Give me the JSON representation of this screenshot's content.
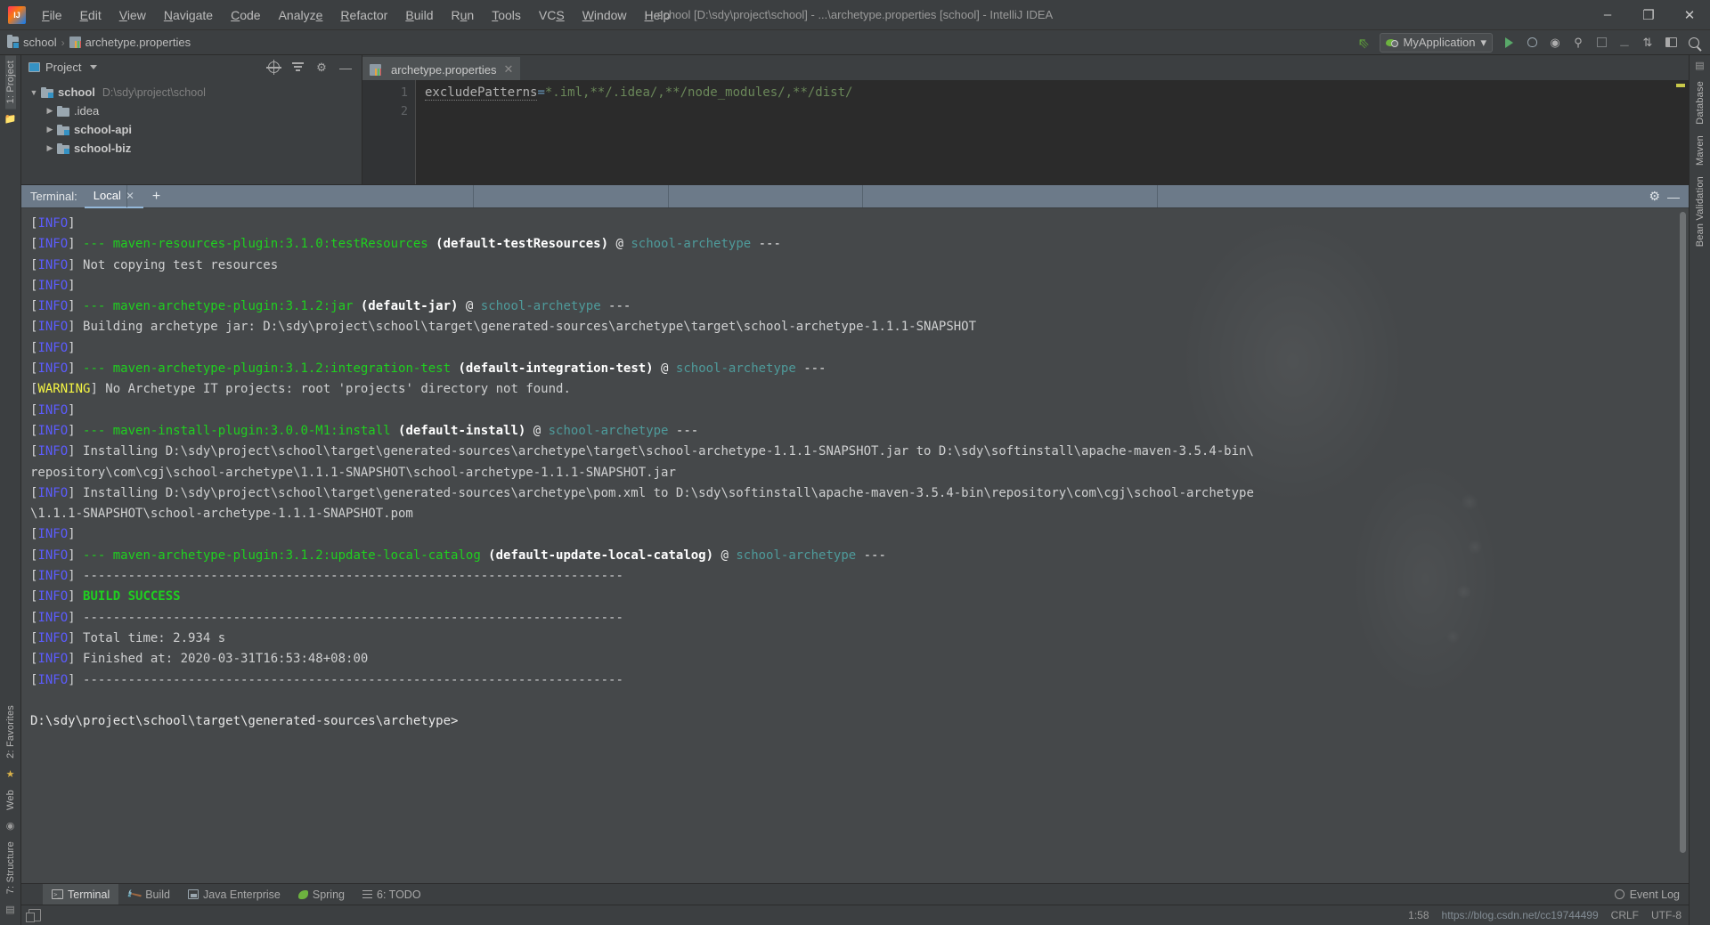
{
  "window": {
    "title": "school [D:\\sdy\\project\\school] - ...\\archetype.properties [school] - IntelliJ IDEA",
    "minimize": "–",
    "maximize": "❐",
    "close": "✕"
  },
  "menu": [
    {
      "label": "File"
    },
    {
      "label": "Edit"
    },
    {
      "label": "View"
    },
    {
      "label": "Navigate"
    },
    {
      "label": "Code"
    },
    {
      "label": "Analyze"
    },
    {
      "label": "Refactor"
    },
    {
      "label": "Build"
    },
    {
      "label": "Run"
    },
    {
      "label": "Tools"
    },
    {
      "label": "VCS"
    },
    {
      "label": "Window"
    },
    {
      "label": "Help"
    }
  ],
  "navbar": {
    "crumbs": [
      "school",
      "archetype.properties"
    ],
    "separator": "›",
    "run_config": "MyApplication",
    "run_config_caret": "▾"
  },
  "project_panel": {
    "title": "Project",
    "caret": "▾",
    "tree": [
      {
        "name": "school",
        "path": "D:\\sdy\\project\\school",
        "twisty": "▼",
        "depth": 0,
        "bold": true,
        "module": true
      },
      {
        "name": ".idea",
        "path": "",
        "twisty": "▶",
        "depth": 1,
        "bold": false,
        "module": false
      },
      {
        "name": "school-api",
        "path": "",
        "twisty": "▶",
        "depth": 1,
        "bold": true,
        "module": true
      },
      {
        "name": "school-biz",
        "path": "",
        "twisty": "▶",
        "depth": 1,
        "bold": true,
        "module": true
      }
    ]
  },
  "editor": {
    "tab_label": "archetype.properties",
    "tab_close": "✕",
    "line_numbers": [
      "1",
      "2"
    ],
    "code_key": "excludePatterns",
    "code_eq": "=",
    "code_value": "*.iml,**/.idea/,**/node_modules/,**/dist/"
  },
  "terminal": {
    "label": "Terminal:",
    "tab": "Local",
    "tab_close": "✕",
    "add": "+",
    "gear": "⚙",
    "minimize": "—",
    "prompt": "D:\\sdy\\project\\school\\target\\generated-sources\\archetype>",
    "lines": [
      [
        {
          "t": "[",
          "c": "br"
        },
        {
          "t": "INFO",
          "c": "info"
        },
        {
          "t": "]",
          "c": "br"
        }
      ],
      [
        {
          "t": "[",
          "c": "br"
        },
        {
          "t": "INFO",
          "c": "info"
        },
        {
          "t": "] ",
          "c": "br"
        },
        {
          "t": "--- ",
          "c": "green"
        },
        {
          "t": "maven-resources-plugin:3.1.0:testResources",
          "c": "green"
        },
        {
          "t": " (default-testResources)",
          "c": "bold"
        },
        {
          "t": " @ ",
          "c": "white"
        },
        {
          "t": "school-archetype",
          "c": "cyan"
        },
        {
          "t": " ---",
          "c": "white"
        }
      ],
      [
        {
          "t": "[",
          "c": "br"
        },
        {
          "t": "INFO",
          "c": "info"
        },
        {
          "t": "] Not copying test resources",
          "c": "dim"
        }
      ],
      [
        {
          "t": "[",
          "c": "br"
        },
        {
          "t": "INFO",
          "c": "info"
        },
        {
          "t": "]",
          "c": "br"
        }
      ],
      [
        {
          "t": "[",
          "c": "br"
        },
        {
          "t": "INFO",
          "c": "info"
        },
        {
          "t": "] ",
          "c": "br"
        },
        {
          "t": "--- ",
          "c": "green"
        },
        {
          "t": "maven-archetype-plugin:3.1.2:jar",
          "c": "green"
        },
        {
          "t": " (default-jar)",
          "c": "bold"
        },
        {
          "t": " @ ",
          "c": "white"
        },
        {
          "t": "school-archetype",
          "c": "cyan"
        },
        {
          "t": " ---",
          "c": "white"
        }
      ],
      [
        {
          "t": "[",
          "c": "br"
        },
        {
          "t": "INFO",
          "c": "info"
        },
        {
          "t": "] Building archetype jar: D:\\sdy\\project\\school\\target\\generated-sources\\archetype\\target\\school-archetype-1.1.1-SNAPSHOT",
          "c": "dim"
        }
      ],
      [
        {
          "t": "[",
          "c": "br"
        },
        {
          "t": "INFO",
          "c": "info"
        },
        {
          "t": "]",
          "c": "br"
        }
      ],
      [
        {
          "t": "[",
          "c": "br"
        },
        {
          "t": "INFO",
          "c": "info"
        },
        {
          "t": "] ",
          "c": "br"
        },
        {
          "t": "--- ",
          "c": "green"
        },
        {
          "t": "maven-archetype-plugin:3.1.2:integration-test",
          "c": "green"
        },
        {
          "t": " (default-integration-test)",
          "c": "bold"
        },
        {
          "t": " @ ",
          "c": "white"
        },
        {
          "t": "school-archetype",
          "c": "cyan"
        },
        {
          "t": " ---",
          "c": "white"
        }
      ],
      [
        {
          "t": "[",
          "c": "br"
        },
        {
          "t": "WARNING",
          "c": "warn"
        },
        {
          "t": "] No Archetype IT projects: root 'projects' directory not found.",
          "c": "dim"
        }
      ],
      [
        {
          "t": "[",
          "c": "br"
        },
        {
          "t": "INFO",
          "c": "info"
        },
        {
          "t": "]",
          "c": "br"
        }
      ],
      [
        {
          "t": "[",
          "c": "br"
        },
        {
          "t": "INFO",
          "c": "info"
        },
        {
          "t": "] ",
          "c": "br"
        },
        {
          "t": "--- ",
          "c": "green"
        },
        {
          "t": "maven-install-plugin:3.0.0-M1:install",
          "c": "green"
        },
        {
          "t": " (default-install)",
          "c": "bold"
        },
        {
          "t": " @ ",
          "c": "white"
        },
        {
          "t": "school-archetype",
          "c": "cyan"
        },
        {
          "t": " ---",
          "c": "white"
        }
      ],
      [
        {
          "t": "[",
          "c": "br"
        },
        {
          "t": "INFO",
          "c": "info"
        },
        {
          "t": "] Installing D:\\sdy\\project\\school\\target\\generated-sources\\archetype\\target\\school-archetype-1.1.1-SNAPSHOT.jar to D:\\sdy\\softinstall\\apache-maven-3.5.4-bin\\",
          "c": "dim"
        }
      ],
      [
        {
          "t": "repository\\com\\cgj\\school-archetype\\1.1.1-SNAPSHOT\\school-archetype-1.1.1-SNAPSHOT.jar",
          "c": "dim"
        }
      ],
      [
        {
          "t": "[",
          "c": "br"
        },
        {
          "t": "INFO",
          "c": "info"
        },
        {
          "t": "] Installing D:\\sdy\\project\\school\\target\\generated-sources\\archetype\\pom.xml to D:\\sdy\\softinstall\\apache-maven-3.5.4-bin\\repository\\com\\cgj\\school-archetype",
          "c": "dim"
        }
      ],
      [
        {
          "t": "\\1.1.1-SNAPSHOT\\school-archetype-1.1.1-SNAPSHOT.pom",
          "c": "dim"
        }
      ],
      [
        {
          "t": "[",
          "c": "br"
        },
        {
          "t": "INFO",
          "c": "info"
        },
        {
          "t": "]",
          "c": "br"
        }
      ],
      [
        {
          "t": "[",
          "c": "br"
        },
        {
          "t": "INFO",
          "c": "info"
        },
        {
          "t": "] ",
          "c": "br"
        },
        {
          "t": "--- ",
          "c": "green"
        },
        {
          "t": "maven-archetype-plugin:3.1.2:update-local-catalog",
          "c": "green"
        },
        {
          "t": " (default-update-local-catalog)",
          "c": "bold"
        },
        {
          "t": " @ ",
          "c": "white"
        },
        {
          "t": "school-archetype",
          "c": "cyan"
        },
        {
          "t": " ---",
          "c": "white"
        }
      ],
      [
        {
          "t": "[",
          "c": "br"
        },
        {
          "t": "INFO",
          "c": "info"
        },
        {
          "t": "] ------------------------------------------------------------------------",
          "c": "dim"
        }
      ],
      [
        {
          "t": "[",
          "c": "br"
        },
        {
          "t": "INFO",
          "c": "info"
        },
        {
          "t": "] ",
          "c": "br"
        },
        {
          "t": "BUILD SUCCESS",
          "c": "bgreen"
        }
      ],
      [
        {
          "t": "[",
          "c": "br"
        },
        {
          "t": "INFO",
          "c": "info"
        },
        {
          "t": "] ------------------------------------------------------------------------",
          "c": "dim"
        }
      ],
      [
        {
          "t": "[",
          "c": "br"
        },
        {
          "t": "INFO",
          "c": "info"
        },
        {
          "t": "] Total time: 2.934 s",
          "c": "dim"
        }
      ],
      [
        {
          "t": "[",
          "c": "br"
        },
        {
          "t": "INFO",
          "c": "info"
        },
        {
          "t": "] Finished at: 2020-03-31T16:53:48+08:00",
          "c": "dim"
        }
      ],
      [
        {
          "t": "[",
          "c": "br"
        },
        {
          "t": "INFO",
          "c": "info"
        },
        {
          "t": "] ------------------------------------------------------------------------",
          "c": "dim"
        }
      ]
    ]
  },
  "left_strip": [
    {
      "label": "1: Project",
      "selected": true
    },
    {
      "label": "2: Favorites",
      "selected": false
    },
    {
      "label": "7: Structure",
      "selected": false
    },
    {
      "label": "Web",
      "selected": false
    }
  ],
  "right_strip": [
    {
      "label": "Database",
      "selected": false
    },
    {
      "label": "Maven",
      "selected": false
    },
    {
      "label": "Bean Validation",
      "selected": false
    }
  ],
  "bottom_bar": {
    "items": [
      {
        "label": "Terminal",
        "icon": "terminal-icon",
        "selected": true
      },
      {
        "label": "Build",
        "icon": "hammer-icon",
        "selected": false
      },
      {
        "label": "Java Enterprise",
        "icon": "java-enterprise-icon",
        "selected": false
      },
      {
        "label": "Spring",
        "icon": "leaf-icon",
        "selected": false
      },
      {
        "label": "6: TODO",
        "icon": "list-icon",
        "selected": false
      }
    ],
    "event_log": "Event Log"
  },
  "status_bar": {
    "caret_position": "1:58",
    "watermark": "https://blog.csdn.net/cc19744499",
    "line_sep": "CRLF",
    "encoding": "UTF-8"
  },
  "colors": {
    "accent_blue": "#3592c4",
    "green": "#1fd01f",
    "info_blue": "#5c5cff",
    "warn_yellow": "#f5f543",
    "cyan": "#4e9a9a",
    "terminal_bg": "#45484a",
    "chrome_bg": "#3c3f41",
    "editor_bg": "#2b2b2b"
  }
}
